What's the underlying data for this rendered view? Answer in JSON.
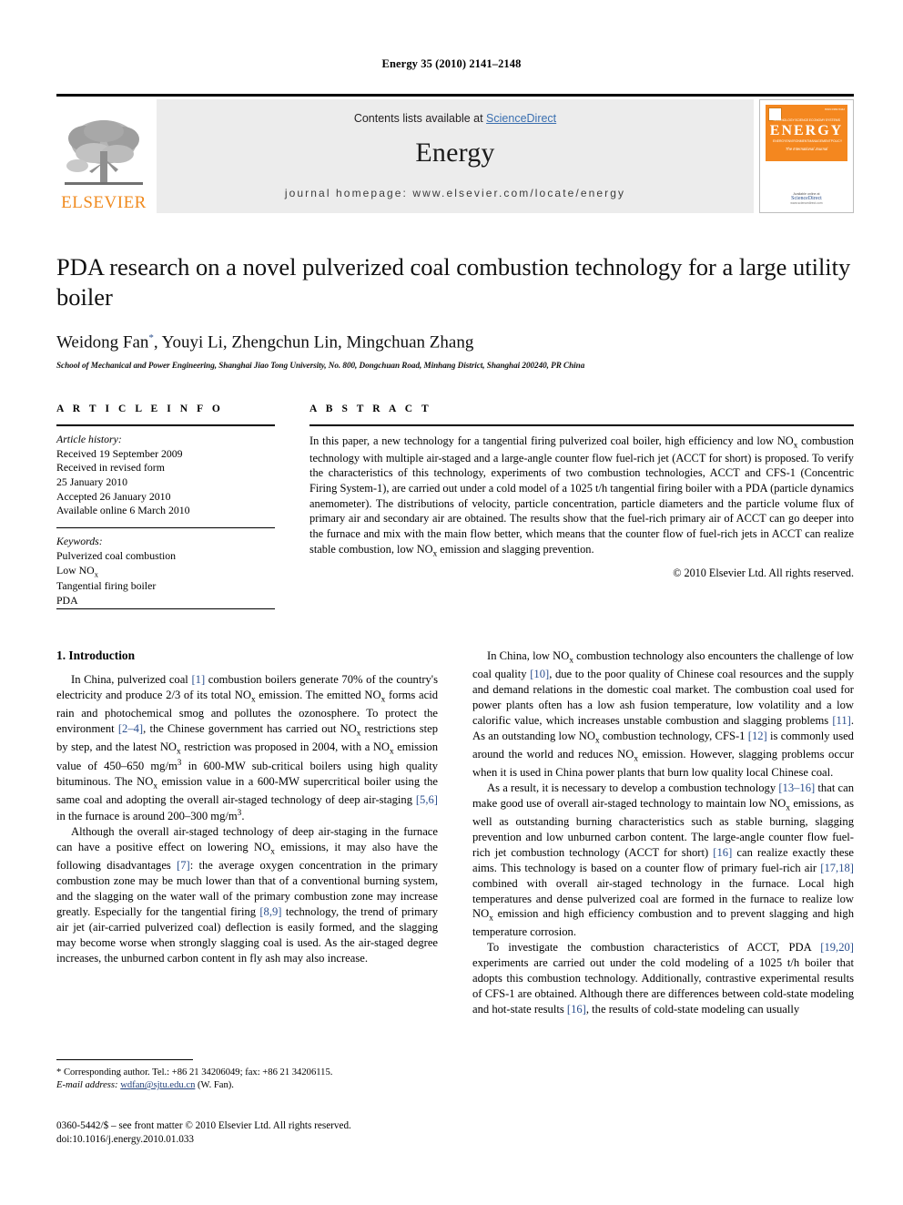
{
  "running_head": "Energy 35 (2010) 2141–2148",
  "banner": {
    "contents_prefix": "Contents lists available at ",
    "sciencedirect": "ScienceDirect",
    "journal_title": "Energy",
    "homepage": "journal homepage: www.elsevier.com/locate/energy",
    "publisher_name": "ELSEVIER",
    "accent_orange": "#F08A1E",
    "link_blue": "#3a6fb0",
    "cover": {
      "title": "ENERGY",
      "subtitle": "The International Journal",
      "words_top": [
        "TECHNOLOGY",
        "SCIENCE",
        "ECONOMY",
        "SYSTEMS"
      ],
      "words_bottom": [
        "ENERGY",
        "ENVIRONMENT",
        "MANAGEMENT",
        "POLICY"
      ],
      "available_at": "Available online at",
      "sciencedirect": "ScienceDirect",
      "url": "www.sciencedirect.com"
    }
  },
  "article": {
    "title": "PDA research on a novel pulverized coal combustion technology for a large utility boiler",
    "authors": "Weidong Fan*, Youyi Li, Zhengchun Lin, Mingchuan Zhang",
    "affiliation": "School of Mechanical and Power Engineering, Shanghai Jiao Tong University, No. 800, Dongchuan Road, Minhang District, Shanghai 200240, PR China"
  },
  "article_info": {
    "heading": "A R T I C L E   I N F O",
    "history_label": "Article history:",
    "history": [
      "Received 19 September 2009",
      "Received in revised form",
      "25 January 2010",
      "Accepted 26 January 2010",
      "Available online 6 March 2010"
    ],
    "keywords_label": "Keywords:",
    "keywords": [
      "Pulverized coal combustion",
      "Low NOx",
      "Tangential firing boiler",
      "PDA"
    ]
  },
  "abstract": {
    "heading": "A B S T R A C T",
    "text": "In this paper, a new technology for a tangential firing pulverized coal boiler, high efficiency and low NOx combustion technology with multiple air-staged and a large-angle counter flow fuel-rich jet (ACCT for short) is proposed. To verify the characteristics of this technology, experiments of two combustion technologies, ACCT and CFS-1 (Concentric Firing System-1), are carried out under a cold model of a 1025 t/h tangential firing boiler with a PDA (particle dynamics anemometer). The distributions of velocity, particle concentration, particle diameters and the particle volume flux of primary air and secondary air are obtained. The results show that the fuel-rich primary air of ACCT can go deeper into the furnace and mix with the main flow better, which means that the counter flow of fuel-rich jets in ACCT can realize stable combustion, low NOx emission and slagging prevention.",
    "copyright": "© 2010 Elsevier Ltd. All rights reserved."
  },
  "body": {
    "section_title": "1.  Introduction",
    "left_paragraphs": [
      "In China, pulverized coal [1] combustion boilers generate 70% of the country's electricity and produce 2/3 of its total NOx emission. The emitted NOx forms acid rain and photochemical smog and pollutes the ozonosphere. To protect the environment [2–4], the Chinese government has carried out NOx restrictions step by step, and the latest NOx restriction was proposed in 2004, with a NOx emission value of 450–650 mg/m3 in 600-MW sub-critical boilers using high quality bituminous. The NOx emission value in a 600-MW supercritical boiler using the same coal and adopting the overall air-staged technology of deep air-staging [5,6] in the furnace is around 200–300 mg/m3.",
      "Although the overall air-staged technology of deep air-staging in the furnace can have a positive effect on lowering NOx emissions, it may also have the following disadvantages [7]: the average oxygen concentration in the primary combustion zone may be much lower than that of a conventional burning system, and the slagging on the water wall of the primary combustion zone may increase greatly. Especially for the tangential firing [8,9] technology, the trend of primary air jet (air-carried pulverized coal) deflection is easily formed, and the slagging may become worse when strongly slagging coal is used. As the air-staged degree increases, the unburned carbon content in fly ash may also increase."
    ],
    "right_paragraphs": [
      "In China, low NOx combustion technology also encounters the challenge of low coal quality [10], due to the poor quality of Chinese coal resources and the supply and demand relations in the domestic coal market. The combustion coal used for power plants often has a low ash fusion temperature, low volatility and a low calorific value, which increases unstable combustion and slagging problems [11]. As an outstanding low NOx combustion technology, CFS-1 [12] is commonly used around the world and reduces NOx emission. However, slagging problems occur when it is used in China power plants that burn low quality local Chinese coal.",
      "As a result, it is necessary to develop a combustion technology [13–16] that can make good use of overall air-staged technology to maintain low NOx emissions, as well as outstanding burning characteristics such as stable burning, slagging prevention and low unburned carbon content. The large-angle counter flow fuel-rich jet combustion technology (ACCT for short) [16] can realize exactly these aims. This technology is based on a counter flow of primary fuel-rich air [17,18] combined with overall air-staged technology in the furnace. Local high temperatures and dense pulverized coal are formed in the furnace to realize low NOx emission and high efficiency combustion and to prevent slagging and high temperature corrosion.",
      "To investigate the combustion characteristics of ACCT, PDA [19,20] experiments are carried out under the cold modeling of a 1025 t/h boiler that adopts this combustion technology. Additionally, contrastive experimental results of CFS-1 are obtained. Although there are differences between cold-state modeling and hot-state results [16], the results of cold-state modeling can usually"
    ]
  },
  "footnote": {
    "corresponding": "* Corresponding author. Tel.: +86 21 34206049; fax: +86 21 34206115.",
    "email_label": "E-mail address:",
    "email": "wdfan@sjtu.edu.cn",
    "email_suffix": "(W. Fan).",
    "imprint_line1": "0360-5442/$ – see front matter © 2010 Elsevier Ltd. All rights reserved.",
    "imprint_line2": "doi:10.1016/j.energy.2010.01.033"
  }
}
